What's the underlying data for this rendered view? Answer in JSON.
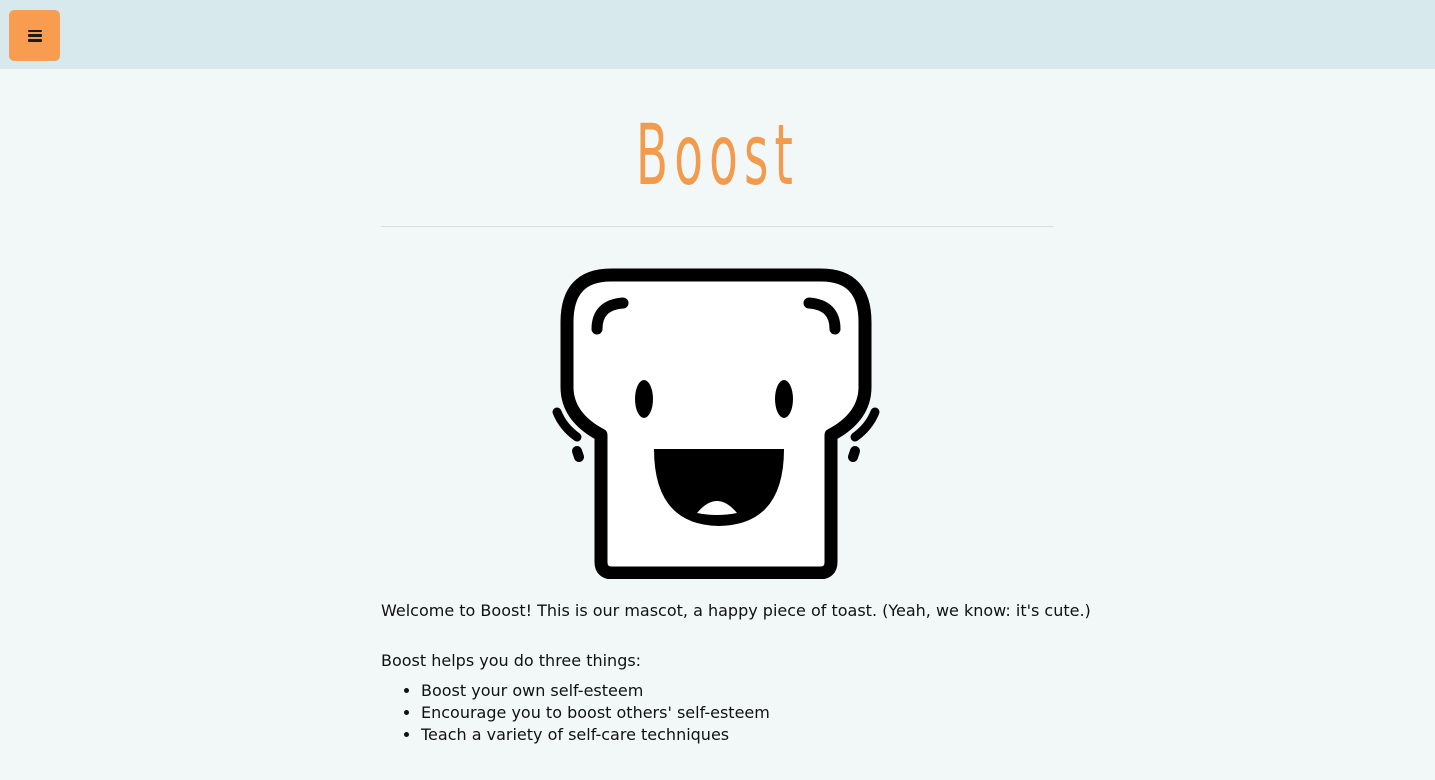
{
  "header": {
    "menu_icon": "hamburger-menu-icon",
    "menu_button_color": "#f89d4f",
    "bar_color": "#d8e9ed"
  },
  "main": {
    "title": "Boost",
    "title_color": "#f39b4c",
    "mascot_icon": "happy-toast-mascot",
    "caption": "Welcome to Boost! This is our mascot, a happy piece of toast. (Yeah, we know: it's cute.)",
    "intro": "Boost helps you do three things:",
    "features": [
      "Boost your own self-esteem",
      "Encourage you to boost others' self-esteem",
      "Teach a variety of self-care techniques"
    ]
  },
  "colors": {
    "page_background": "#f2f8f8"
  }
}
